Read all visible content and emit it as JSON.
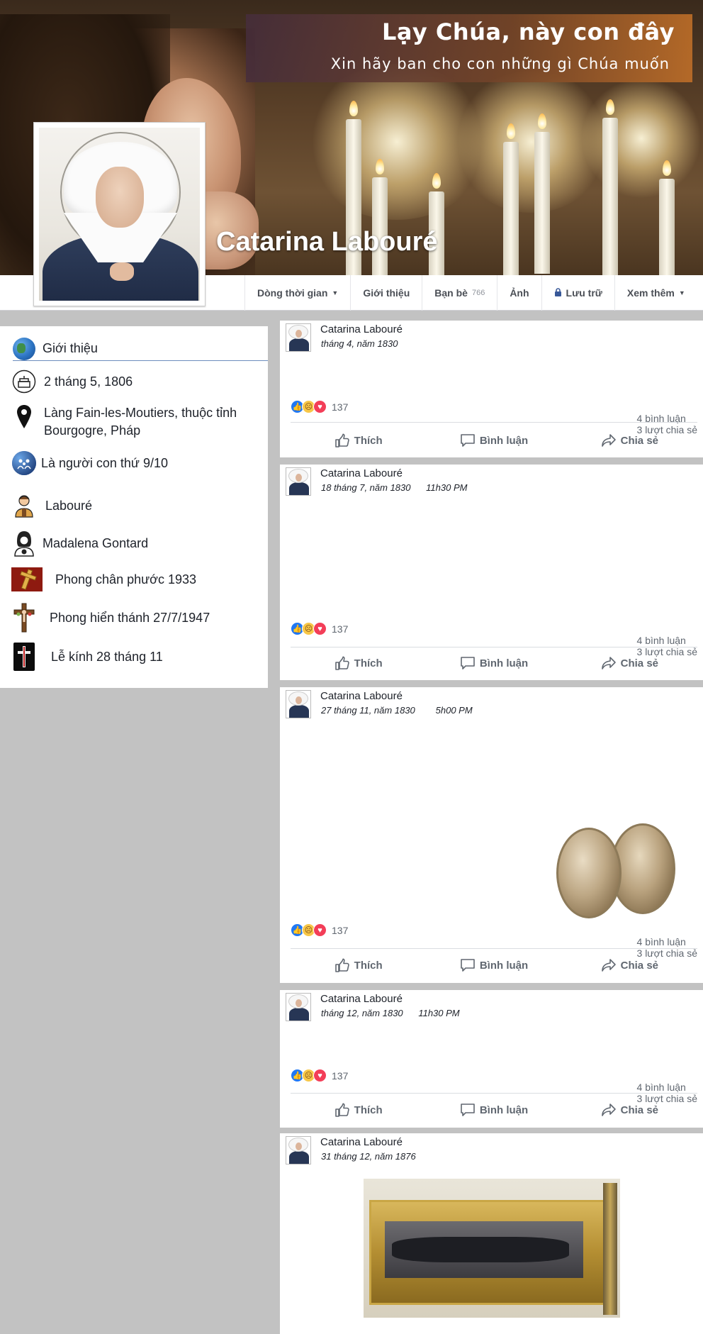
{
  "cover": {
    "banner_title": "Lạy Chúa, này con đây",
    "banner_subtitle": "Xin hãy ban cho con những gì Chúa muốn"
  },
  "profile": {
    "name": "Catarina Labouré"
  },
  "nav": {
    "tabs": [
      {
        "label": "Dòng thời gian"
      },
      {
        "label": "Giới thiệu"
      },
      {
        "label": "Bạn bè",
        "count": "766"
      },
      {
        "label": "Ảnh"
      },
      {
        "label": "Lưu trữ"
      },
      {
        "label": "Xem thêm"
      }
    ]
  },
  "intro": {
    "title": "Giới thiệu",
    "items": [
      {
        "text": "2 tháng 5, 1806",
        "icon": "birthday-cake-icon"
      },
      {
        "text": "Làng Fain-les-Moutiers, thuộc tỉnh Bourgogre, Pháp",
        "icon": "location-pin-icon"
      },
      {
        "text": "Là người con thứ 9/10",
        "icon": "family-icon"
      },
      {
        "text": "Labouré",
        "icon": "father-icon"
      },
      {
        "text": "Madalena Gontard",
        "icon": "mother-icon"
      },
      {
        "text": "Phong chân phước 1933",
        "icon": "cross-icon"
      },
      {
        "text": "Phong hiển thánh 27/7/1947",
        "icon": "crucifix-icon"
      },
      {
        "text": "Lễ kính 28 tháng 11",
        "icon": "cross-badge-icon"
      }
    ]
  },
  "posts": [
    {
      "author": "Catarina Labouré",
      "date": "tháng 4, năm 1830",
      "reactions": "137",
      "comments": "4 bình luận",
      "shares": "3 lượt chia sẻ"
    },
    {
      "author": "Catarina Labouré",
      "date": "18 tháng 7, năm 1830      11h30 PM",
      "reactions": "137",
      "comments": "4 bình luận",
      "shares": "3 lượt chia sẻ"
    },
    {
      "author": "Catarina Labouré",
      "date": "27 tháng 11, năm 1830        5h00 PM",
      "reactions": "137",
      "comments": "4 bình luận",
      "shares": "3 lượt chia sẻ"
    },
    {
      "author": "Catarina Labouré",
      "date": "tháng 12, năm 1830      11h30 PM",
      "reactions": "137",
      "comments": "4 bình luận",
      "shares": "3 lượt chia sẻ"
    },
    {
      "author": "Catarina Labouré",
      "date": "31 tháng 12, năm 1876"
    }
  ],
  "actions": {
    "like": "Thích",
    "comment": "Bình luận",
    "share": "Chia sẻ"
  },
  "colors": {
    "fb_blue": "#385898",
    "like_blue": "#2078f4",
    "love_red": "#f33e58",
    "sad_yellow": "#f7c748"
  }
}
